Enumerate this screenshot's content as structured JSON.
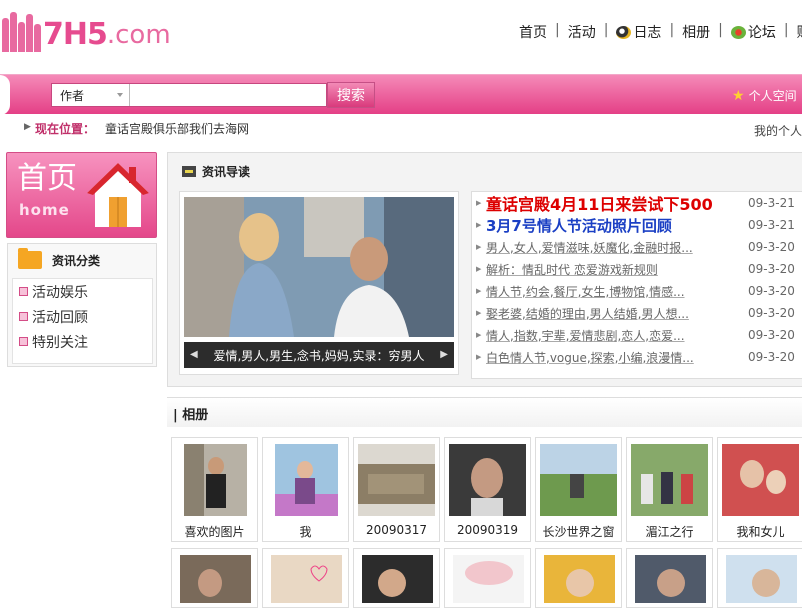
{
  "logo": {
    "brand": "7H5",
    "domain": ".com"
  },
  "topnav": [
    {
      "label": "首页",
      "icon": ""
    },
    {
      "label": "活动",
      "icon": ""
    },
    {
      "label": "日志",
      "icon": "blog-icon"
    },
    {
      "label": "相册",
      "icon": ""
    },
    {
      "label": "论坛",
      "icon": "forum-icon"
    },
    {
      "label": "购物",
      "icon": ""
    }
  ],
  "search": {
    "select_value": "作者",
    "placeholder": "",
    "button": "搜索"
  },
  "personal_space": "个人空间",
  "breadcrumb": {
    "label": "现在位置：",
    "path": "童话宫殿俱乐部我们去海网",
    "right": "我的个人"
  },
  "home_box": {
    "title": "首页",
    "subtitle": "home"
  },
  "categories": {
    "title": "资讯分类",
    "items": [
      "活动娱乐",
      "活动回顾",
      "特别关注"
    ]
  },
  "news": {
    "title": "资讯导读",
    "photo_caption": "爱情,男人,男生,念书,妈妈,实录：穷男人",
    "items": [
      {
        "text": "童话宫殿4月11日来尝试下500",
        "date": "09-3-21",
        "style": "red"
      },
      {
        "text": "3月7号情人节活动照片回顾",
        "date": "09-3-21",
        "style": "blue"
      },
      {
        "text": "男人,女人,爱情滋味,妖魔化,金融时报...",
        "date": "09-3-20",
        "style": "normal"
      },
      {
        "text": "解析：情乱时代 恋爱游戏新规则",
        "date": "09-3-20",
        "style": "normal"
      },
      {
        "text": "情人节,约会,餐厅,女生,博物馆,情感...",
        "date": "09-3-20",
        "style": "normal"
      },
      {
        "text": "娶老婆,结婚的理由,男人结婚,男人想...",
        "date": "09-3-20",
        "style": "normal"
      },
      {
        "text": "情人,指数,宇辈,爱情悲剧,恋人,恋爱...",
        "date": "09-3-20",
        "style": "normal"
      },
      {
        "text": "白色情人节,vogue,探索,小编,浪漫情...",
        "date": "09-3-20",
        "style": "normal"
      }
    ]
  },
  "album": {
    "title": "| 相册",
    "items": [
      "喜欢的图片",
      "我",
      "20090317",
      "20090319",
      "长沙世界之窗",
      "湄江之行",
      "我和女儿"
    ]
  },
  "colors": {
    "pink": "#e43f86",
    "red": "#dd0000",
    "blue": "#1a3fc4"
  }
}
